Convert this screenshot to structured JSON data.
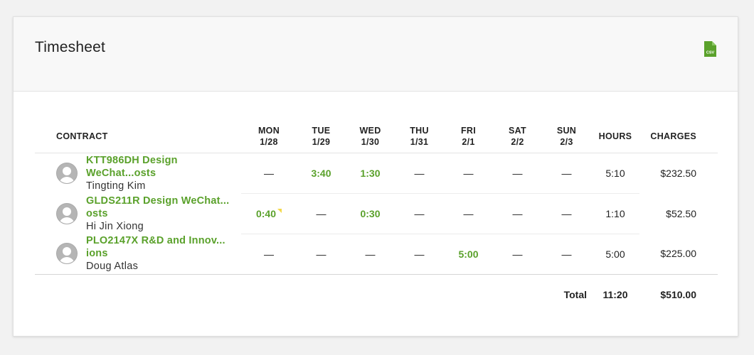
{
  "header": {
    "title": "Timesheet",
    "export_icon": "csv-file-icon",
    "export_icon_label": "CSV",
    "accent_color": "#5aa12b"
  },
  "table": {
    "columns": {
      "contract": "CONTRACT",
      "days": [
        {
          "day": "MON",
          "date": "1/28"
        },
        {
          "day": "TUE",
          "date": "1/29"
        },
        {
          "day": "WED",
          "date": "1/30"
        },
        {
          "day": "THU",
          "date": "1/31"
        },
        {
          "day": "FRI",
          "date": "2/1"
        },
        {
          "day": "SAT",
          "date": "2/2"
        },
        {
          "day": "SUN",
          "date": "2/3"
        }
      ],
      "hours": "HOURS",
      "charges": "CHARGES"
    },
    "rows": [
      {
        "contract": "KTT986DH Design WeChat...osts",
        "freelancer": "Tingting Kim",
        "days": [
          "—",
          "3:40",
          "1:30",
          "—",
          "—",
          "—",
          "—"
        ],
        "hours": "5:10",
        "charges": "$232.50"
      },
      {
        "contract": "GLDS211R Design WeChat... osts",
        "freelancer": "Hi Jin Xiong",
        "days": [
          "0:40",
          "—",
          "0:30",
          "—",
          "—",
          "—",
          "—"
        ],
        "hours": "1:10",
        "charges": "$52.50"
      },
      {
        "contract": "PLO2147X R&D and Innov... ions",
        "freelancer": "Doug Atlas",
        "days": [
          "—",
          "—",
          "—",
          "—",
          "5:00",
          "—",
          "—"
        ],
        "hours": "5:00",
        "charges": "$225.00"
      }
    ],
    "total": {
      "label": "Total",
      "hours": "11:20",
      "charges": "$510.00"
    }
  }
}
